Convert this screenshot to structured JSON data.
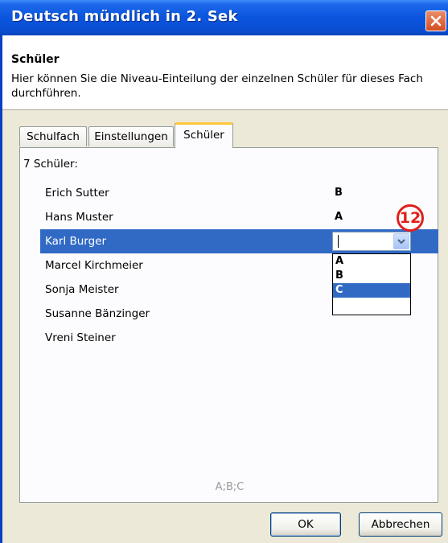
{
  "window": {
    "title": "Deutsch mündlich in 2. Sek"
  },
  "header": {
    "title": "Schüler",
    "description": "Hier können Sie die Niveau-Einteilung der einzelnen Schüler für dieses Fach durchführen."
  },
  "tabs": [
    {
      "label": "Schulfach",
      "active": false
    },
    {
      "label": "Einstellungen",
      "active": false
    },
    {
      "label": "Schüler",
      "active": true
    }
  ],
  "panel": {
    "count_label": "7 Schüler:",
    "students": [
      {
        "name": "Erich Sutter",
        "level": "B"
      },
      {
        "name": "Hans Muster",
        "level": "A"
      },
      {
        "name": "Karl Burger",
        "level": ""
      },
      {
        "name": "Marcel Kirchmeier",
        "level": ""
      },
      {
        "name": "Sonja Meister",
        "level": ""
      },
      {
        "name": "Susanne Bänzinger",
        "level": ""
      },
      {
        "name": "Vreni Steiner",
        "level": ""
      }
    ],
    "selected_student": "Karl Burger",
    "dropdown_options": [
      "A",
      "B",
      "C"
    ],
    "highlighted_option": "C",
    "hint": "A;B;C"
  },
  "callout": {
    "number": "12",
    "color": "#e0201c"
  },
  "buttons": {
    "ok": "OK",
    "cancel": "Abbrechen"
  },
  "colors": {
    "selection": "#316ac5",
    "titlebar": "#0b55de",
    "active_tab_accent": "#ffc83c"
  }
}
